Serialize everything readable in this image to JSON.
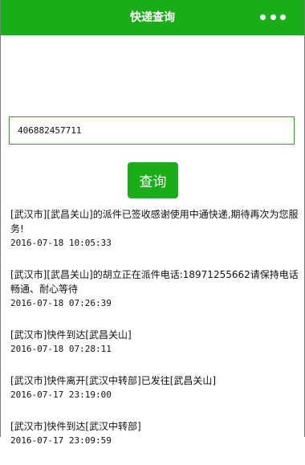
{
  "header": {
    "title": "快递查询",
    "menu_icon": "more-dots-icon"
  },
  "search": {
    "value": "406882457711"
  },
  "query_button": {
    "label": "查询"
  },
  "results": [
    {
      "desc": "[武汉市][武昌关山]的派件已签收感谢使用中通快递,期待再次为您服务!",
      "time": "2016-07-18 10:05:33"
    },
    {
      "desc": "[武汉市][武昌关山]的胡立正在派件电话:18971255662请保持电话畅通、耐心等待",
      "time": "2016-07-18 07:26:39"
    },
    {
      "desc": "[武汉市]快件到达[武昌关山]",
      "time": "2016-07-18 07:28:11"
    },
    {
      "desc": "[武汉市]快件离开[武汉中转部]已发往[武昌关山]",
      "time": "2016-07-17 23:19:00"
    },
    {
      "desc": "[武汉市]快件到达[武汉中转部]",
      "time": "2016-07-17 23:09:59"
    }
  ],
  "colors": {
    "brand": "#1aad19"
  }
}
